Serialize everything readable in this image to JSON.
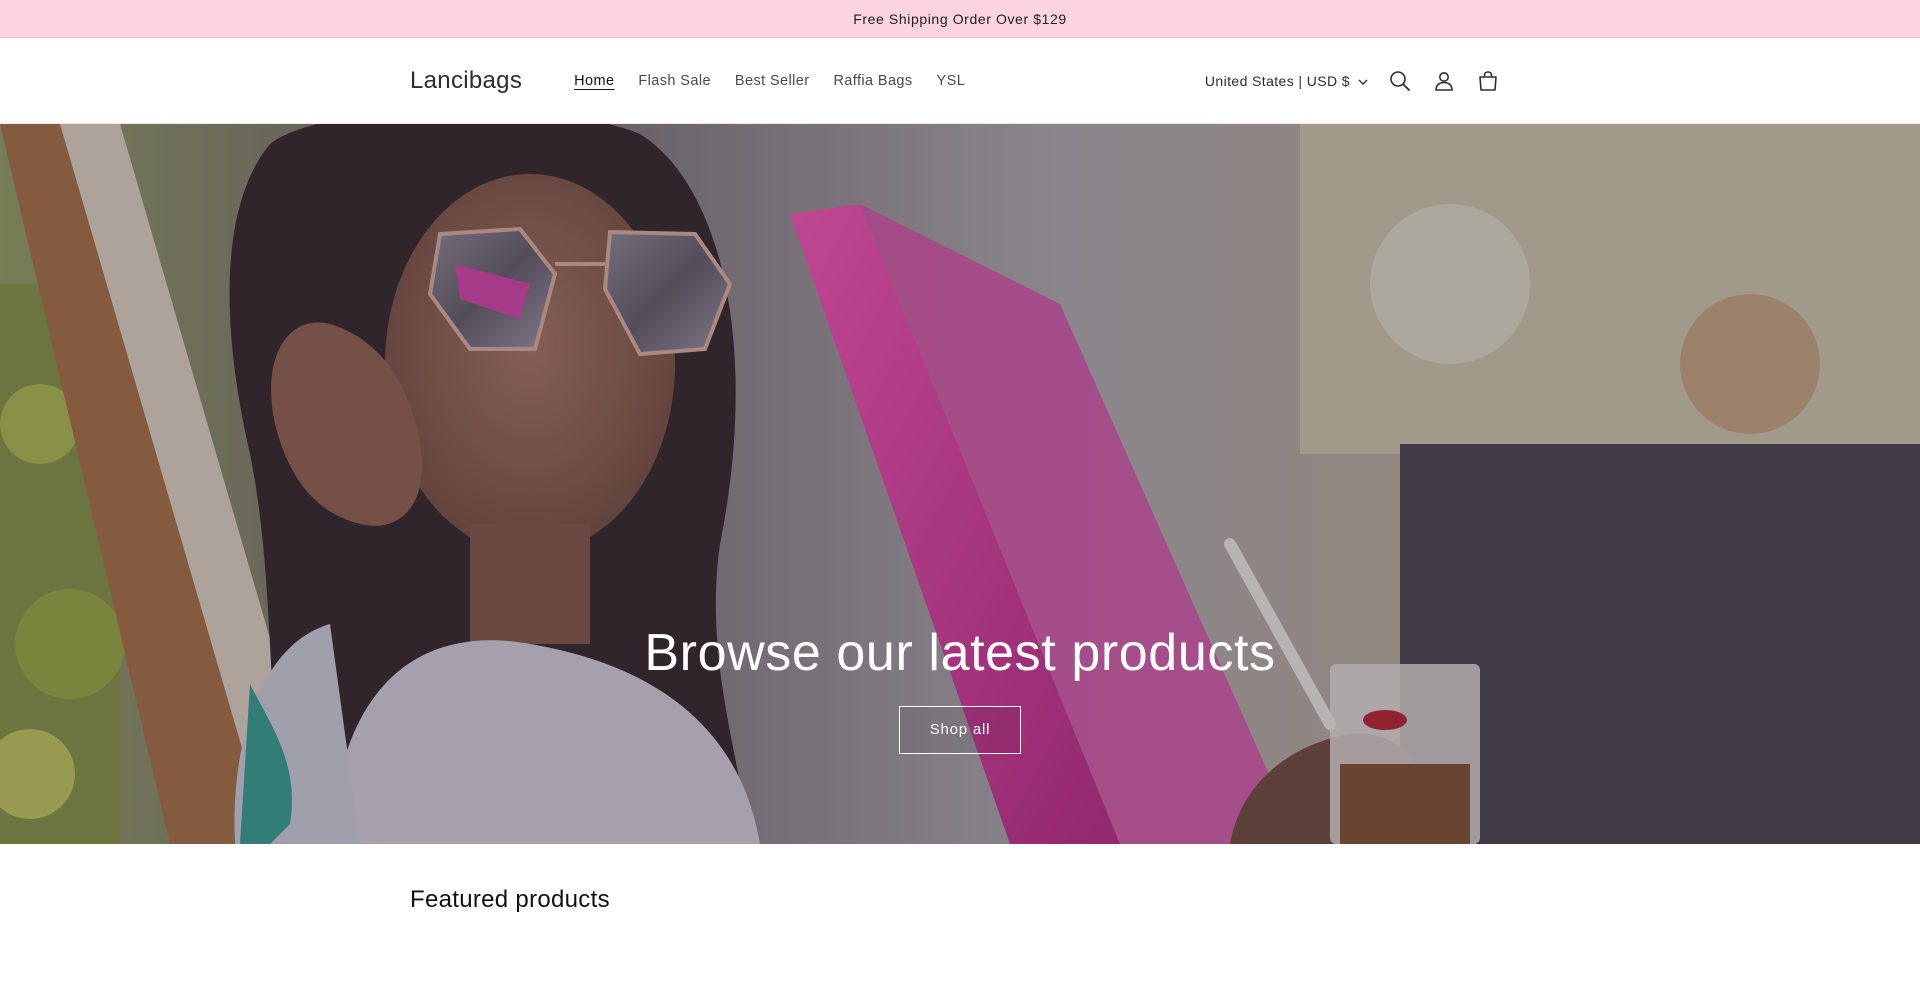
{
  "announcement": {
    "text": "Free Shipping Order Over $129"
  },
  "header": {
    "logo": "Lancibags",
    "nav": [
      {
        "label": "Home",
        "active": true
      },
      {
        "label": "Flash Sale",
        "active": false
      },
      {
        "label": "Best Seller",
        "active": false
      },
      {
        "label": "Raffia Bags",
        "active": false
      },
      {
        "label": "YSL",
        "active": false
      }
    ],
    "localization": "United States | USD $",
    "icons": [
      "search-icon",
      "account-icon",
      "cart-icon"
    ]
  },
  "hero": {
    "title": "Browse our latest products",
    "button": "Shop all"
  },
  "featured": {
    "title": "Featured products"
  },
  "colors": {
    "announcement_bg": "#fbd3e1",
    "accent_pink": "#e0258f",
    "text": "#121212"
  }
}
